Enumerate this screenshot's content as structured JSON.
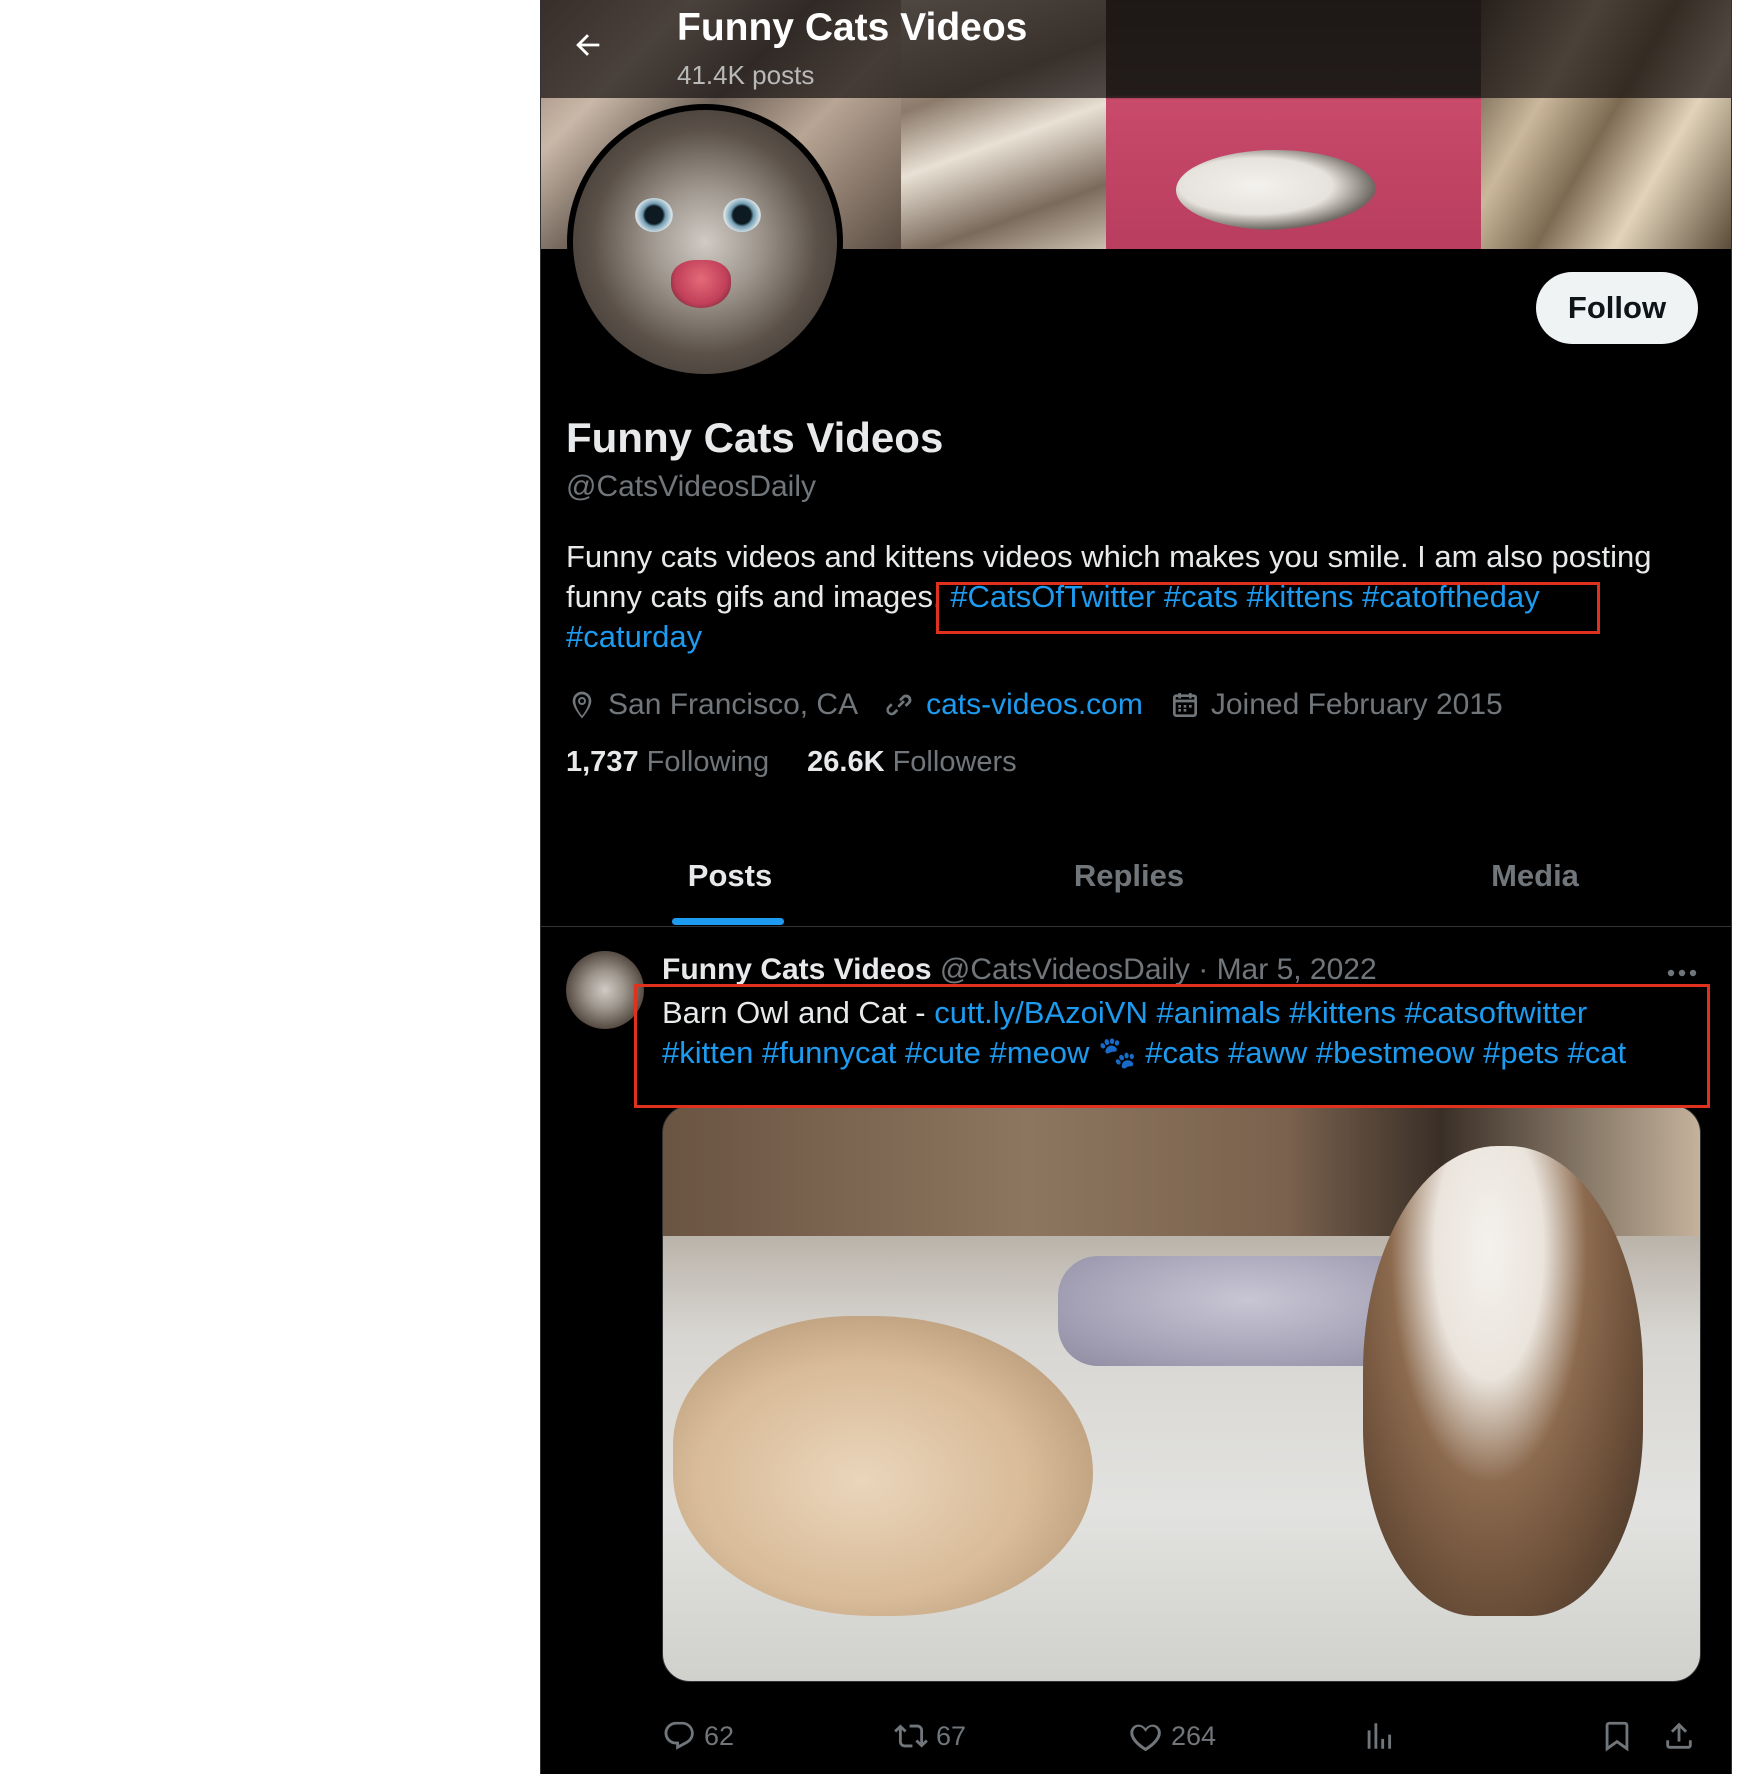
{
  "topbar": {
    "title": "Funny Cats Videos",
    "subtitle": "41.4K posts"
  },
  "profile": {
    "name": "Funny Cats Videos",
    "handle": "@CatsVideosDaily",
    "follow_label": "Follow",
    "bio_text": "Funny cats videos and kittens videos which makes you smile. I am also posting funny cats gifs and images.",
    "bio_tags": [
      "#CatsOfTwitter",
      "#cats",
      "#kittens",
      "#catoftheday",
      "#caturday"
    ],
    "location": "San Francisco, CA",
    "website": "cats-videos.com",
    "joined": "Joined February 2015",
    "following_count": "1,737",
    "following_label": "Following",
    "followers_count": "26.6K",
    "followers_label": "Followers"
  },
  "tabs": [
    {
      "label": "Posts",
      "active": true
    },
    {
      "label": "Replies",
      "active": false
    },
    {
      "label": "Media",
      "active": false
    }
  ],
  "post": {
    "author_name": "Funny Cats Videos",
    "author_handle": "@CatsVideosDaily",
    "separator": "·",
    "date": "Mar 5, 2022",
    "text_prefix": "Barn Owl and Cat - ",
    "link": "cutt.ly/BAzoiVN",
    "tags_line1": [
      "#animals",
      "#kittens",
      "#catsoftwitter"
    ],
    "tags_line2": [
      "#kitten",
      "#funnycat",
      "#cute",
      "#meow"
    ],
    "emoji": "🐾",
    "tags_line3": [
      "#cats",
      "#aww",
      "#bestmeow",
      "#pets",
      "#cat"
    ],
    "replies": "62",
    "reposts": "67",
    "likes": "264"
  },
  "colors": {
    "accent": "#1d9bf0",
    "background": "#000000",
    "muted": "#71767b",
    "highlight_box": "#e0301e"
  },
  "icons": [
    "back-arrow-icon",
    "location-pin-icon",
    "link-icon",
    "calendar-icon",
    "more-icon",
    "reply-icon",
    "repost-icon",
    "like-icon",
    "views-icon",
    "bookmark-icon",
    "share-icon"
  ]
}
